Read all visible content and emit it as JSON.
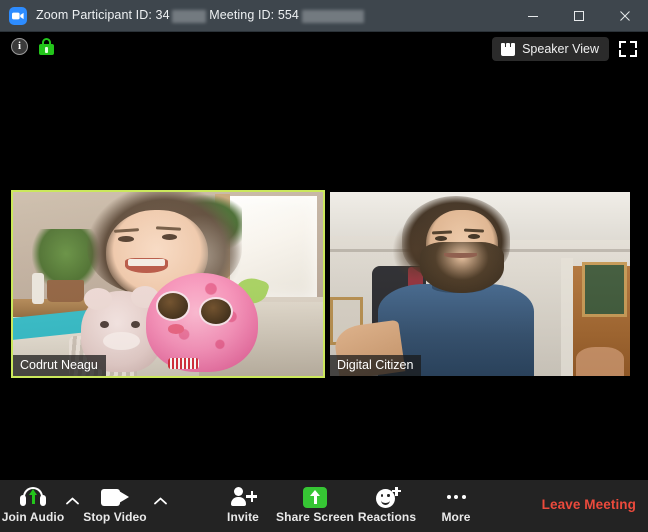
{
  "window": {
    "app_name": "Zoom",
    "title_prefix": "Zoom Participant ID:",
    "participant_id": "34",
    "meeting_label": "Meeting ID:",
    "meeting_id": "554",
    "logo_icon": "zoom-video-logo-icon",
    "controls": {
      "minimize": "minimize-icon",
      "maximize": "maximize-icon",
      "close": "close-icon"
    }
  },
  "stage": {
    "status": {
      "info_icon": "info-icon",
      "info_glyph": "i",
      "lock_icon": "green-padlock-icon"
    },
    "view_controls": {
      "speaker_view_label": "Speaker View",
      "speaker_view_icon": "gallery-grid-icon",
      "fullscreen_icon": "enter-fullscreen-icon"
    },
    "tiles": [
      {
        "name": "Codrut Neagu",
        "active_speaker": true,
        "border_color": "#cbe85c",
        "scene": "child holding plush toys in a bright room with window and plants"
      },
      {
        "name": "Digital Citizen",
        "active_speaker": false,
        "border_color": "transparent",
        "scene": "bearded man in blue t-shirt in a light room with wooden door"
      }
    ]
  },
  "toolbar": {
    "items": [
      {
        "label": "Join Audio",
        "icon": "headset-join-audio-icon",
        "has_caret": true,
        "caret_icon": "chevron-up-icon"
      },
      {
        "label": "Stop Video",
        "icon": "video-camera-icon",
        "has_caret": true,
        "caret_icon": "chevron-up-icon"
      },
      {
        "label": "Invite",
        "icon": "add-person-icon",
        "has_caret": false
      },
      {
        "label": "Share Screen",
        "icon": "share-screen-up-arrow-icon",
        "has_caret": false
      },
      {
        "label": "Reactions",
        "icon": "smiley-plus-icon",
        "has_caret": false
      },
      {
        "label": "More",
        "icon": "ellipsis-icon",
        "has_caret": false
      }
    ],
    "leave_label": "Leave Meeting",
    "leave_color": "#ec4a3c",
    "accent_green": "#36c634"
  }
}
